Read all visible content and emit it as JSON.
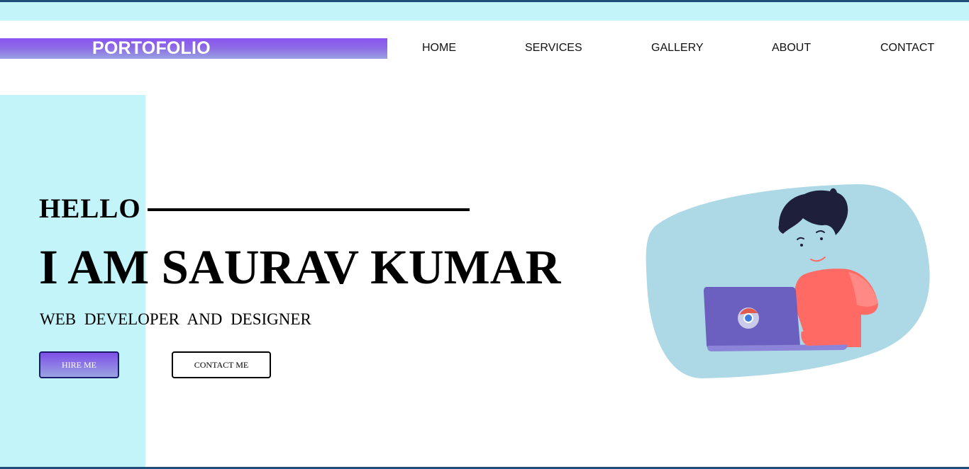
{
  "brand": {
    "logo_text": "PORTOFOLIO"
  },
  "nav": {
    "items": [
      {
        "label": "HOME"
      },
      {
        "label": "SERVICES"
      },
      {
        "label": "GALLERY"
      },
      {
        "label": "ABOUT"
      },
      {
        "label": "CONTACT"
      }
    ]
  },
  "hero": {
    "greeting": "HELLO",
    "name": "I AM SAURAV KUMAR",
    "role": "WEB DEVELOPER AND DESIGNER",
    "buttons": {
      "hire_label": "HIRE ME",
      "contact_label": "CONTACT ME"
    }
  },
  "illustration": {
    "icon": "person-with-laptop-icon"
  },
  "colors": {
    "accent_cyan": "#c3f4fa",
    "accent_purple": "#8a55f0",
    "blob_blue": "#add8e6",
    "laptop_purple": "#6b5fbf",
    "shirt_coral": "#ff6b64",
    "hair_navy": "#1e1f3b",
    "border_navy": "#1f4e79"
  }
}
